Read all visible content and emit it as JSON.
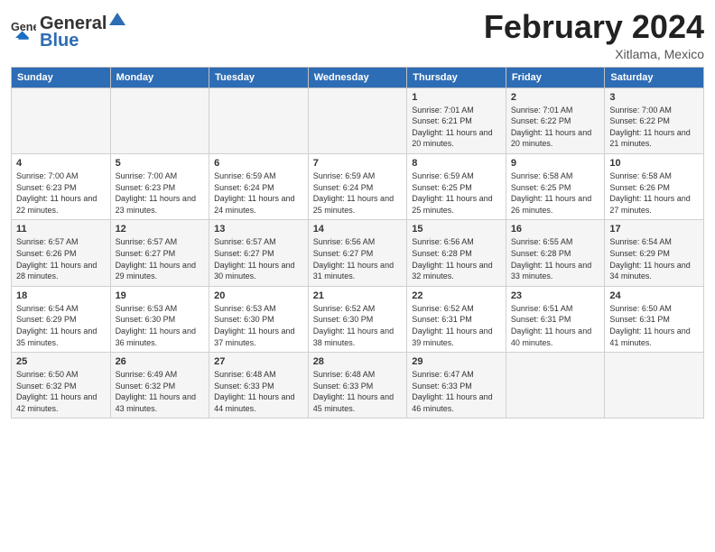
{
  "header": {
    "logo_general": "General",
    "logo_blue": "Blue",
    "month_title": "February 2024",
    "location": "Xitlama, Mexico"
  },
  "days_of_week": [
    "Sunday",
    "Monday",
    "Tuesday",
    "Wednesday",
    "Thursday",
    "Friday",
    "Saturday"
  ],
  "weeks": [
    [
      {
        "day": "",
        "info": ""
      },
      {
        "day": "",
        "info": ""
      },
      {
        "day": "",
        "info": ""
      },
      {
        "day": "",
        "info": ""
      },
      {
        "day": "1",
        "info": "Sunrise: 7:01 AM\nSunset: 6:21 PM\nDaylight: 11 hours and 20 minutes."
      },
      {
        "day": "2",
        "info": "Sunrise: 7:01 AM\nSunset: 6:22 PM\nDaylight: 11 hours and 20 minutes."
      },
      {
        "day": "3",
        "info": "Sunrise: 7:00 AM\nSunset: 6:22 PM\nDaylight: 11 hours and 21 minutes."
      }
    ],
    [
      {
        "day": "4",
        "info": "Sunrise: 7:00 AM\nSunset: 6:23 PM\nDaylight: 11 hours and 22 minutes."
      },
      {
        "day": "5",
        "info": "Sunrise: 7:00 AM\nSunset: 6:23 PM\nDaylight: 11 hours and 23 minutes."
      },
      {
        "day": "6",
        "info": "Sunrise: 6:59 AM\nSunset: 6:24 PM\nDaylight: 11 hours and 24 minutes."
      },
      {
        "day": "7",
        "info": "Sunrise: 6:59 AM\nSunset: 6:24 PM\nDaylight: 11 hours and 25 minutes."
      },
      {
        "day": "8",
        "info": "Sunrise: 6:59 AM\nSunset: 6:25 PM\nDaylight: 11 hours and 25 minutes."
      },
      {
        "day": "9",
        "info": "Sunrise: 6:58 AM\nSunset: 6:25 PM\nDaylight: 11 hours and 26 minutes."
      },
      {
        "day": "10",
        "info": "Sunrise: 6:58 AM\nSunset: 6:26 PM\nDaylight: 11 hours and 27 minutes."
      }
    ],
    [
      {
        "day": "11",
        "info": "Sunrise: 6:57 AM\nSunset: 6:26 PM\nDaylight: 11 hours and 28 minutes."
      },
      {
        "day": "12",
        "info": "Sunrise: 6:57 AM\nSunset: 6:27 PM\nDaylight: 11 hours and 29 minutes."
      },
      {
        "day": "13",
        "info": "Sunrise: 6:57 AM\nSunset: 6:27 PM\nDaylight: 11 hours and 30 minutes."
      },
      {
        "day": "14",
        "info": "Sunrise: 6:56 AM\nSunset: 6:27 PM\nDaylight: 11 hours and 31 minutes."
      },
      {
        "day": "15",
        "info": "Sunrise: 6:56 AM\nSunset: 6:28 PM\nDaylight: 11 hours and 32 minutes."
      },
      {
        "day": "16",
        "info": "Sunrise: 6:55 AM\nSunset: 6:28 PM\nDaylight: 11 hours and 33 minutes."
      },
      {
        "day": "17",
        "info": "Sunrise: 6:54 AM\nSunset: 6:29 PM\nDaylight: 11 hours and 34 minutes."
      }
    ],
    [
      {
        "day": "18",
        "info": "Sunrise: 6:54 AM\nSunset: 6:29 PM\nDaylight: 11 hours and 35 minutes."
      },
      {
        "day": "19",
        "info": "Sunrise: 6:53 AM\nSunset: 6:30 PM\nDaylight: 11 hours and 36 minutes."
      },
      {
        "day": "20",
        "info": "Sunrise: 6:53 AM\nSunset: 6:30 PM\nDaylight: 11 hours and 37 minutes."
      },
      {
        "day": "21",
        "info": "Sunrise: 6:52 AM\nSunset: 6:30 PM\nDaylight: 11 hours and 38 minutes."
      },
      {
        "day": "22",
        "info": "Sunrise: 6:52 AM\nSunset: 6:31 PM\nDaylight: 11 hours and 39 minutes."
      },
      {
        "day": "23",
        "info": "Sunrise: 6:51 AM\nSunset: 6:31 PM\nDaylight: 11 hours and 40 minutes."
      },
      {
        "day": "24",
        "info": "Sunrise: 6:50 AM\nSunset: 6:31 PM\nDaylight: 11 hours and 41 minutes."
      }
    ],
    [
      {
        "day": "25",
        "info": "Sunrise: 6:50 AM\nSunset: 6:32 PM\nDaylight: 11 hours and 42 minutes."
      },
      {
        "day": "26",
        "info": "Sunrise: 6:49 AM\nSunset: 6:32 PM\nDaylight: 11 hours and 43 minutes."
      },
      {
        "day": "27",
        "info": "Sunrise: 6:48 AM\nSunset: 6:33 PM\nDaylight: 11 hours and 44 minutes."
      },
      {
        "day": "28",
        "info": "Sunrise: 6:48 AM\nSunset: 6:33 PM\nDaylight: 11 hours and 45 minutes."
      },
      {
        "day": "29",
        "info": "Sunrise: 6:47 AM\nSunset: 6:33 PM\nDaylight: 11 hours and 46 minutes."
      },
      {
        "day": "",
        "info": ""
      },
      {
        "day": "",
        "info": ""
      }
    ]
  ]
}
